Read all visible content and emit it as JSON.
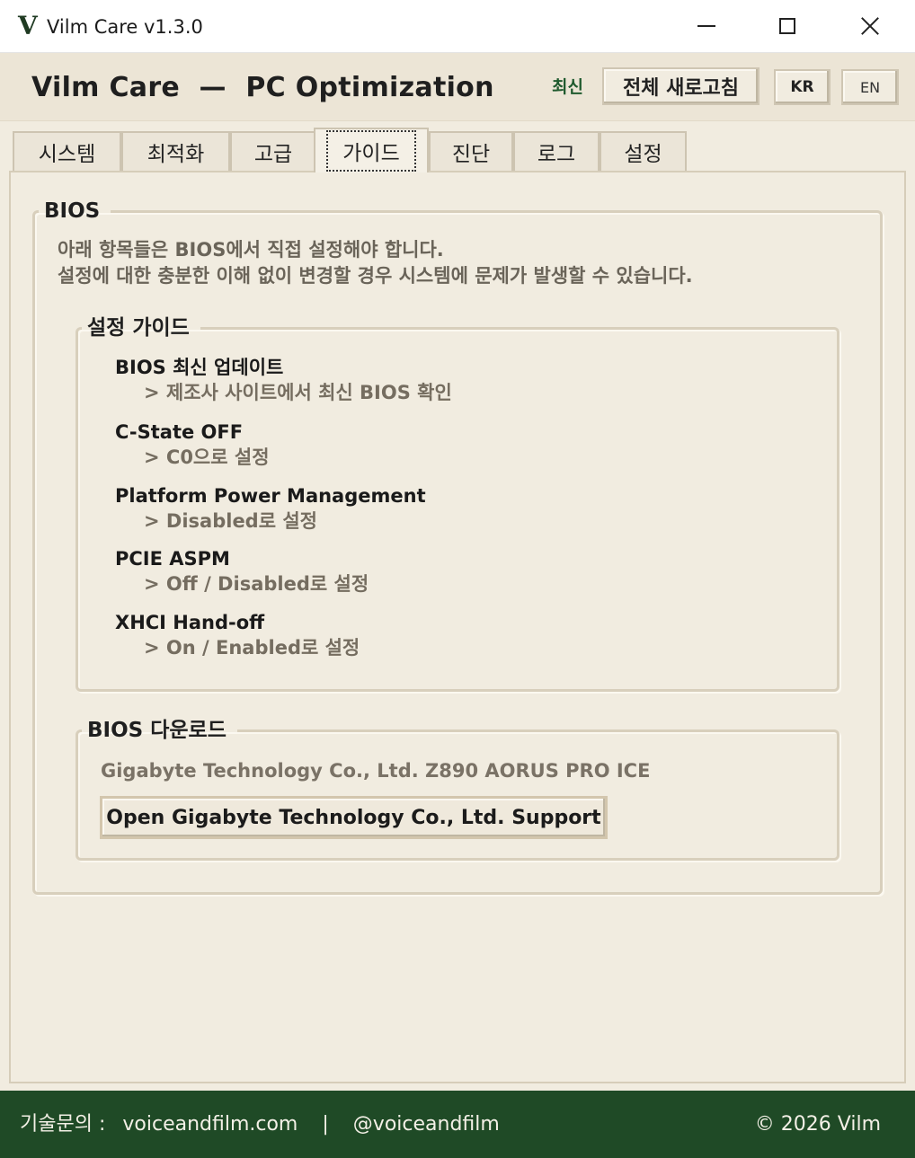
{
  "window": {
    "app_icon": "V",
    "title": "Vilm Care v1.3.0",
    "minimize_icon": "minimize-icon",
    "maximize_icon": "maximize-icon",
    "close_icon": "close-icon"
  },
  "header": {
    "title": "Vilm Care  —  PC Optimization",
    "status": "최신",
    "refresh_all": "전체 새로고침",
    "lang_kr": "KR",
    "lang_en": "EN"
  },
  "tabs": [
    {
      "label": "시스템"
    },
    {
      "label": "최적화"
    },
    {
      "label": "고급"
    },
    {
      "label": "가이드",
      "active": true
    },
    {
      "label": "진단"
    },
    {
      "label": "로그"
    },
    {
      "label": "설정"
    }
  ],
  "bios": {
    "legend": "BIOS",
    "intro_line1": "아래 항목들은 BIOS에서 직접 설정해야 합니다.",
    "intro_line2": "설정에 대한 충분한 이해 없이 변경할 경우 시스템에 문제가 발생할 수 있습니다.",
    "guide": {
      "legend": "설정 가이드",
      "items": [
        {
          "title": "BIOS 최신 업데이트",
          "detail": "> 제조사 사이트에서 최신 BIOS 확인"
        },
        {
          "title": "C-State OFF",
          "detail": "> C0으로 설정"
        },
        {
          "title": "Platform Power Management",
          "detail": "> Disabled로 설정"
        },
        {
          "title": "PCIE ASPM",
          "detail": "> Off / Disabled로 설정"
        },
        {
          "title": "XHCI Hand-off",
          "detail": "> On / Enabled로 설정"
        }
      ]
    },
    "download": {
      "legend": "BIOS 다운로드",
      "vendor": "Gigabyte Technology Co., Ltd. Z890 AORUS PRO ICE",
      "button": "Open Gigabyte Technology Co., Ltd. Support"
    }
  },
  "footer": {
    "support_label": "기술문의 :",
    "website": "voiceandfilm.com",
    "separator": "|",
    "handle": "@voiceandfilm",
    "copyright": "© 2026 Vilm"
  },
  "colors": {
    "background": "#f1ece0",
    "footer": "#1f4a26",
    "status_green": "#1f5a2e"
  }
}
